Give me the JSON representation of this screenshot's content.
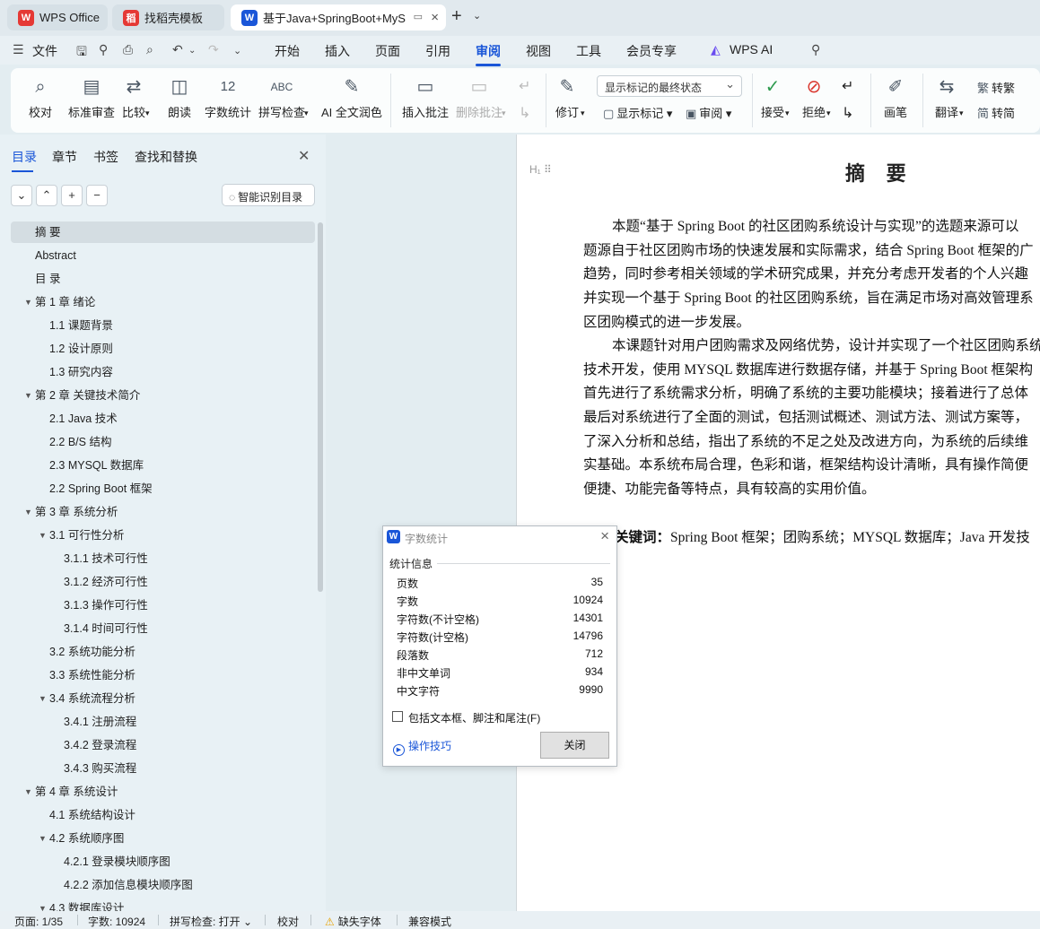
{
  "tabs": [
    {
      "label": "WPS Office",
      "logo": "W",
      "color": "#e53935",
      "active": false
    },
    {
      "label": "找稻壳模板",
      "logo": "稻",
      "color": "#e53935",
      "active": false
    },
    {
      "label": "基于Java+SpringBoot+MyS",
      "logo": "W",
      "color": "#1a56d8",
      "active": true
    }
  ],
  "menubar": {
    "file": "文件",
    "items": [
      "开始",
      "插入",
      "页面",
      "引用",
      "审阅",
      "视图",
      "工具",
      "会员专享",
      "WPS AI"
    ],
    "selected": "审阅"
  },
  "ribbon": {
    "buttons": [
      {
        "label": "校对",
        "icon": "proofread-icon"
      },
      {
        "label": "标准审查",
        "icon": "standard-review-icon"
      },
      {
        "label": "比较",
        "icon": "compare-icon"
      },
      {
        "label": "朗读",
        "icon": "read-aloud-icon"
      },
      {
        "label": "字数统计",
        "icon": "word-count-icon"
      },
      {
        "label": "拼写检查",
        "icon": "spell-check-icon"
      },
      {
        "label": "AI 全文润色",
        "icon": "ai-polish-icon"
      },
      {
        "label": "插入批注",
        "icon": "insert-comment-icon"
      },
      {
        "label": "删除批注",
        "icon": "delete-comment-icon"
      },
      {
        "label": "修订",
        "icon": "track-changes-icon"
      },
      {
        "label": "接受",
        "icon": "accept-icon"
      },
      {
        "label": "拒绝",
        "icon": "reject-icon"
      },
      {
        "label": "画笔",
        "icon": "pen-icon"
      },
      {
        "label": "翻译",
        "icon": "translate-icon"
      }
    ],
    "markup_dropdown": "显示标记的最终状态",
    "show_markup": "显示标记",
    "review": "审阅",
    "to_traditional": "转繁",
    "to_simplified": "转简",
    "ribbon_glyph_abc": "ABC",
    "ribbon_glyph_12": "12"
  },
  "left_panel": {
    "tabs": [
      "目录",
      "章节",
      "书签",
      "查找和替换"
    ],
    "selected_tab": "目录",
    "smart_toc": "智能识别目录",
    "toc": [
      {
        "label": "摘  要",
        "level": 0,
        "arrow": false,
        "selected": true
      },
      {
        "label": "Abstract",
        "level": 0,
        "arrow": false
      },
      {
        "label": "目  录",
        "level": 0,
        "arrow": false
      },
      {
        "label": "第 1 章  绪论",
        "level": 0,
        "arrow": true
      },
      {
        "label": "1.1  课题背景",
        "level": 1,
        "arrow": false
      },
      {
        "label": "1.2    设计原则",
        "level": 1,
        "arrow": false
      },
      {
        "label": "1.3    研究内容",
        "level": 1,
        "arrow": false
      },
      {
        "label": "第 2 章    关键技术简介",
        "level": 0,
        "arrow": true
      },
      {
        "label": "2.1 Java 技术",
        "level": 1,
        "arrow": false
      },
      {
        "label": "2.2 B/S 结构",
        "level": 1,
        "arrow": false
      },
      {
        "label": "2.3 MYSQL 数据库",
        "level": 1,
        "arrow": false
      },
      {
        "label": "2.2 Spring Boot 框架",
        "level": 1,
        "arrow": false
      },
      {
        "label": "第 3 章  系统分析",
        "level": 0,
        "arrow": true
      },
      {
        "label": "3.1  可行性分析",
        "level": 1,
        "arrow": true
      },
      {
        "label": "3.1.1  技术可行性",
        "level": 2,
        "arrow": false
      },
      {
        "label": "3.1.2  经济可行性",
        "level": 2,
        "arrow": false
      },
      {
        "label": "3.1.3  操作可行性",
        "level": 2,
        "arrow": false
      },
      {
        "label": "3.1.4  时间可行性",
        "level": 2,
        "arrow": false
      },
      {
        "label": "3.2  系统功能分析",
        "level": 1,
        "arrow": false
      },
      {
        "label": "3.3  系统性能分析",
        "level": 1,
        "arrow": false
      },
      {
        "label": "3.4  系统流程分析",
        "level": 1,
        "arrow": true
      },
      {
        "label": "3.4.1 注册流程",
        "level": 2,
        "arrow": false
      },
      {
        "label": "3.4.2 登录流程",
        "level": 2,
        "arrow": false
      },
      {
        "label": "3.4.3 购买流程",
        "level": 2,
        "arrow": false
      },
      {
        "label": "第 4 章    系统设计",
        "level": 0,
        "arrow": true
      },
      {
        "label": "4.1  系统结构设计",
        "level": 1,
        "arrow": false
      },
      {
        "label": "4.2 系统顺序图",
        "level": 1,
        "arrow": true
      },
      {
        "label": "4.2.1 登录模块顺序图",
        "level": 2,
        "arrow": false
      },
      {
        "label": "4.2.2 添加信息模块顺序图",
        "level": 2,
        "arrow": false
      },
      {
        "label": "4.3  数据库设计",
        "level": 1,
        "arrow": true
      }
    ]
  },
  "document": {
    "heading_marker": "H",
    "title": "摘 要",
    "paragraph1": [
      "本题“基于 Spring Boot 的社区团购系统设计与实现”的选题来源可以",
      "题源自于社区团购市场的快速发展和实际需求，结合 Spring Boot 框架的广",
      "趋势，同时参考相关领域的学术研究成果，并充分考虑开发者的个人兴趣",
      "并实现一个基于 Spring Boot 的社区团购系统，旨在满足市场对高效管理系",
      "区团购模式的进一步发展。"
    ],
    "paragraph2": [
      "本课题针对用户团购需求及网络优势，设计并实现了一个社区团购系统",
      "技术开发，使用 MYSQL 数据库进行数据存储，并基于 Spring Boot 框架构",
      "首先进行了系统需求分析，明确了系统的主要功能模块；接着进行了总体",
      "最后对系统进行了全面的测试，包括测试概述、测试方法、测试方案等，",
      "了深入分析和总结，指出了系统的不足之处及改进方向，为系统的后续维",
      "实基础。本系统布局合理，色彩和谐，框架结构设计清晰，具有操作简便",
      "便捷、功能完备等特点，具有较高的实用价值。"
    ],
    "keywords_label": "关键词：",
    "keywords": "Spring Boot 框架；团购系统；MYSQL 数据库；Java 开发技"
  },
  "dialog": {
    "logo": "W",
    "title": "字数统计",
    "group": "统计信息",
    "rows": [
      {
        "label": "页数",
        "value": "35"
      },
      {
        "label": "字数",
        "value": "10924"
      },
      {
        "label": "字符数(不计空格)",
        "value": "14301"
      },
      {
        "label": "字符数(计空格)",
        "value": "14796"
      },
      {
        "label": "段落数",
        "value": "712"
      },
      {
        "label": "非中文单词",
        "value": "934"
      },
      {
        "label": "中文字符",
        "value": "9990"
      }
    ],
    "include_label": "包括文本框、脚注和尾注(F)",
    "tips": "操作技巧",
    "close": "关闭"
  },
  "statusbar": {
    "page": "页面: 1/35",
    "words": "字数: 10924",
    "spell": "拼写检查: 打开",
    "proof": "校对",
    "missing_font": "缺失字体",
    "compat": "兼容模式"
  }
}
